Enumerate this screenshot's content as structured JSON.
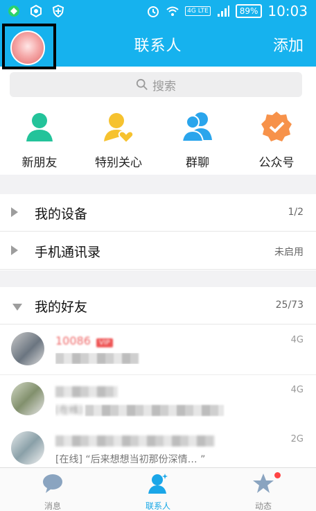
{
  "status": {
    "network": "4G LTE",
    "battery": "89%",
    "time": "10:03"
  },
  "header": {
    "title": "联系人",
    "add_label": "添加"
  },
  "search": {
    "placeholder": "搜索"
  },
  "quick": [
    {
      "label": "新朋友",
      "icon": "person-icon",
      "color": "#23c39a"
    },
    {
      "label": "特别关心",
      "icon": "person-heart-icon",
      "color": "#f6c22f"
    },
    {
      "label": "群聊",
      "icon": "group-icon",
      "color": "#2aa5ec"
    },
    {
      "label": "公众号",
      "icon": "badge-check-icon",
      "color": "#f7924a"
    }
  ],
  "groups": [
    {
      "title": "我的设备",
      "count": "1/2"
    },
    {
      "title": "手机通讯录",
      "count": "未启用"
    },
    {
      "title": "我的好友",
      "count": "25/73"
    }
  ],
  "friends": [
    {
      "name": "10086",
      "badge": "VIP",
      "network": "4G",
      "message": ""
    },
    {
      "name": "",
      "network": "4G",
      "message": "[在线]"
    },
    {
      "name": "",
      "network": "2G",
      "message": "[在线] “后来想想当初那份深情… ”"
    }
  ],
  "tabs": [
    {
      "label": "消息",
      "icon": "chat-bubble-icon"
    },
    {
      "label": "联系人",
      "icon": "contacts-icon"
    },
    {
      "label": "动态",
      "icon": "star-icon"
    }
  ],
  "colors": {
    "accent": "#16b2ee",
    "active_tab": "#16a7e6"
  }
}
